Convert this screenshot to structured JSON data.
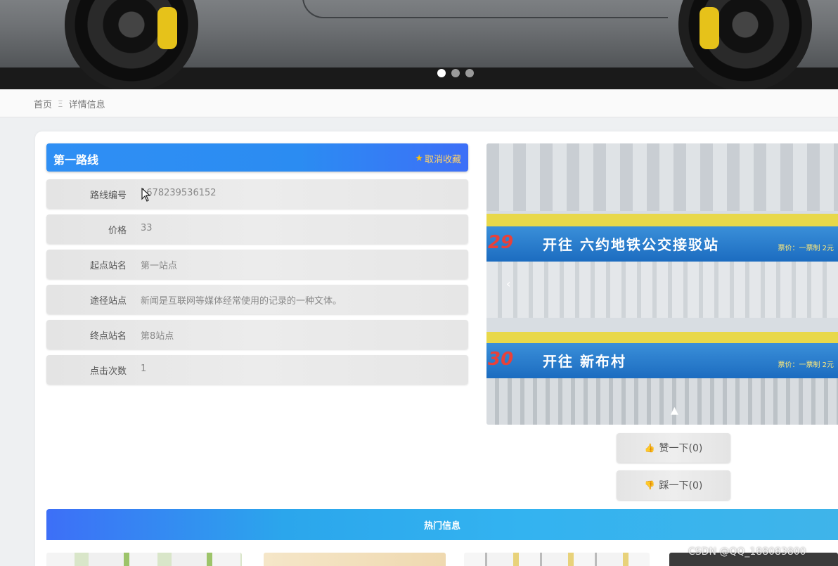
{
  "banner": {
    "slides": 3,
    "active_slide": 1
  },
  "breadcrumb": {
    "home": "首页",
    "separator": "Ξ",
    "current": "详情信息"
  },
  "detail": {
    "title": "第一路线",
    "favorite_label": "取消收藏",
    "fields": [
      {
        "label": "路线编号",
        "value": "1678239536152"
      },
      {
        "label": "价格",
        "value": "33"
      },
      {
        "label": "起点站名",
        "value": "第一站点"
      },
      {
        "label": "途径站点",
        "value": "新闻是互联网等媒体经常使用的记录的一种文体。"
      },
      {
        "label": "终点站名",
        "value": "第8站点"
      },
      {
        "label": "点击次数",
        "value": "1"
      }
    ]
  },
  "photo": {
    "route_a_number": "29",
    "route_a_destination": "开往 六约地铁公交接驳站",
    "route_a_price": "票价：一票制 2元",
    "route_b_number": "30",
    "route_b_destination": "开往 新布村",
    "route_b_price": "票价：一票制 2元"
  },
  "votes": {
    "like_label": "赞一下(0)",
    "dislike_label": "踩一下(0)"
  },
  "hot": {
    "title": "热门信息"
  },
  "watermark": "CSDN @QQ_188083800",
  "colors": {
    "title_bar": "#2f8ff4",
    "hot_bar": "#33b3f0",
    "favorite": "#ffd36b"
  }
}
